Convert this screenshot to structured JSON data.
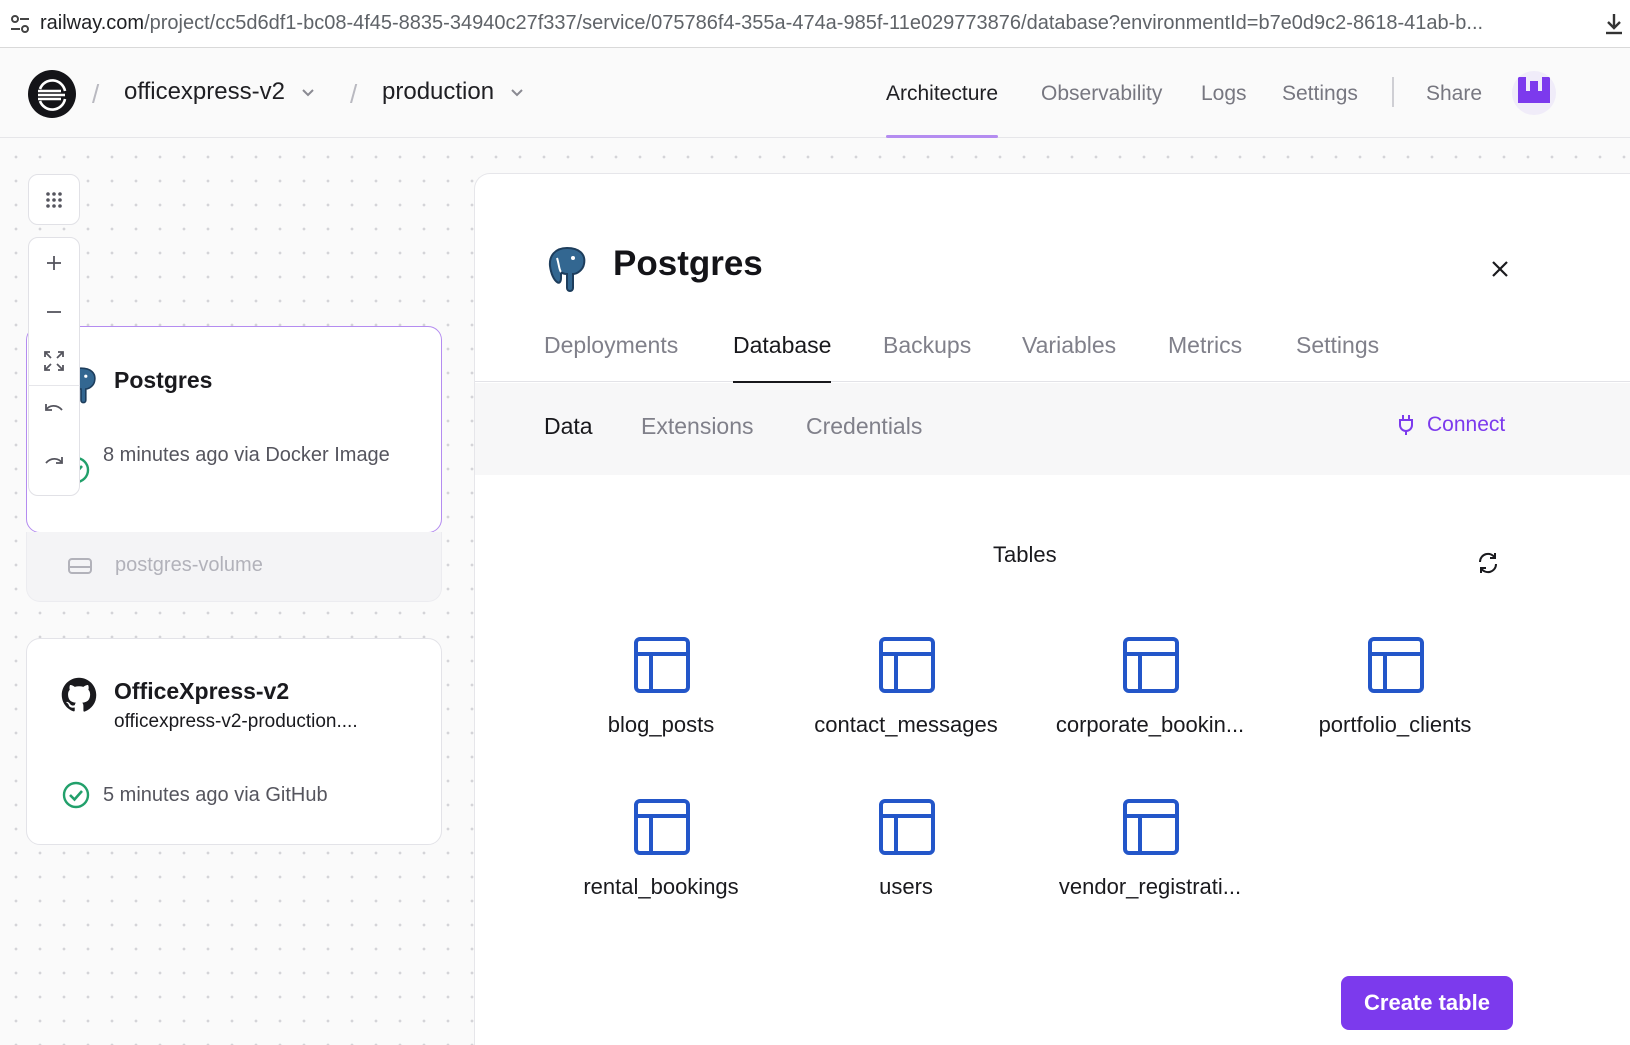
{
  "browser": {
    "url_host": "railway.com",
    "url_path": "/project/cc5d6df1-bc08-4f45-8835-34940c27f337/service/075786f4-355a-474a-985f-11e029773876/database?environmentId=b7e0d9c2-8618-41ab-b..."
  },
  "header": {
    "project": "officexpress-v2",
    "environment": "production",
    "nav": {
      "architecture": "Architecture",
      "observability": "Observability",
      "logs": "Logs",
      "settings": "Settings",
      "share": "Share"
    }
  },
  "canvas": {
    "postgres_card": {
      "title": "Postgres",
      "status": "8 minutes ago via Docker Image",
      "volume": "postgres-volume"
    },
    "app_card": {
      "title": "OfficeXpress-v2",
      "domain": "officexpress-v2-production....",
      "status": "5 minutes ago via GitHub"
    }
  },
  "panel": {
    "title": "Postgres",
    "tabs": {
      "deployments": "Deployments",
      "database": "Database",
      "backups": "Backups",
      "variables": "Variables",
      "metrics": "Metrics",
      "settings": "Settings"
    },
    "subtabs": {
      "data": "Data",
      "extensions": "Extensions",
      "credentials": "Credentials"
    },
    "connect_label": "Connect",
    "tables_heading": "Tables",
    "tables": [
      "blog_posts",
      "contact_messages",
      "corporate_bookin...",
      "portfolio_clients",
      "rental_bookings",
      "users",
      "vendor_registrati..."
    ],
    "create_button": "Create table"
  },
  "colors": {
    "accent": "#7c3aed",
    "selected_border": "#b48cf0",
    "table_icon": "#2356c9",
    "success": "#22a06b"
  }
}
